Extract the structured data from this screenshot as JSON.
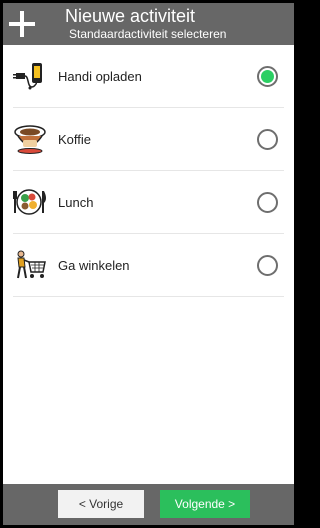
{
  "header": {
    "title": "Nieuwe activiteit",
    "subtitle": "Standaardactiviteit selecteren"
  },
  "activities": [
    {
      "label": "Handi opladen",
      "icon": "phone-charger-icon",
      "selected": true
    },
    {
      "label": "Koffie",
      "icon": "coffee-cup-icon",
      "selected": false
    },
    {
      "label": "Lunch",
      "icon": "lunch-plate-icon",
      "selected": false
    },
    {
      "label": "Ga winkelen",
      "icon": "shopping-cart-icon",
      "selected": false
    }
  ],
  "footer": {
    "prev_label": "< Vorige",
    "next_label": "Volgende >"
  },
  "colors": {
    "header_bg": "#676767",
    "accent_green": "#2bcf63"
  }
}
